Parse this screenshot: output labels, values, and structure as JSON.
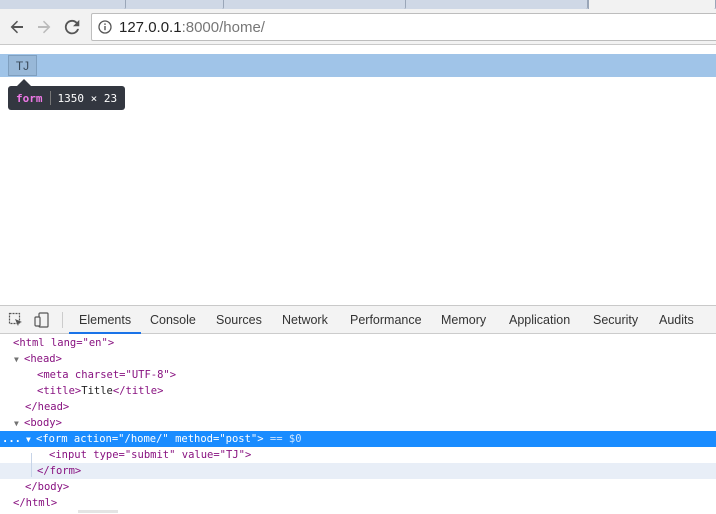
{
  "browser": {
    "tabs": [
      {
        "fragment": "",
        "state": "inactive"
      },
      {
        "fragment": "",
        "state": "inactive"
      },
      {
        "fragment": "",
        "state": "inactive"
      },
      {
        "fragment": "",
        "state": "inactive"
      },
      {
        "fragment": "",
        "state": "active"
      }
    ],
    "url_host": "127.0.0.1",
    "url_rest": ":8000/home/"
  },
  "page": {
    "submit_value": "TJ",
    "tooltip": {
      "tag": "form",
      "size": "1350 × 23"
    }
  },
  "devtools": {
    "tabs": [
      "Elements",
      "Console",
      "Sources",
      "Network",
      "Performance",
      "Memory",
      "Application",
      "Security",
      "Audits"
    ],
    "active_tab": "Elements",
    "dom": {
      "html_open": "<html lang=\"en\">",
      "head_open": "<head>",
      "meta": "<meta charset=\"UTF-8\">",
      "title_open": "<title>",
      "title_text": "Title",
      "title_close": "</title>",
      "head_close": "</head>",
      "body_open": "<body>",
      "form_open": "<form action=\"/home/\" method=\"post\">",
      "form_eq": "== $0",
      "input": "<input type=\"submit\" value=\"TJ\">",
      "form_close": "</form>",
      "body_close": "</body>",
      "html_close": "</html>"
    },
    "selected_marker": "..."
  },
  "colors": {
    "accent": "#1a73e8",
    "selection": "#1a8cff",
    "highlight": "#a0c4e8",
    "tag": "#881280",
    "attr_name": "#994500",
    "attr_value": "#1a1aa6"
  },
  "icons": [
    "back-arrow-icon",
    "forward-arrow-icon",
    "reload-icon",
    "info-icon",
    "inspect-element-icon",
    "device-toolbar-icon"
  ]
}
